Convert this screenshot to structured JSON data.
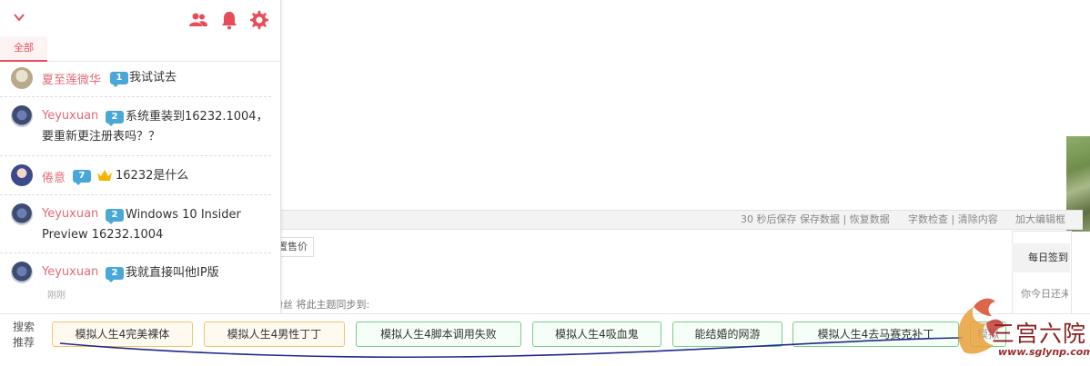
{
  "panel": {
    "tab_all": "全部",
    "messages": [
      {
        "user": "夏至莲微华",
        "level": "1",
        "text": "我试试去"
      },
      {
        "user": "Yeyuxuan",
        "level": "2",
        "text_line1": "系统重装到16232.1004，",
        "text_line2": "要重新更注册表吗？？"
      },
      {
        "user": "倦意",
        "level": "7",
        "text": "16232是什么"
      },
      {
        "user": "Yeyuxuan",
        "level": "2",
        "text_line1": "Windows 10 Insider",
        "text_line2": "Preview 16232.1004"
      },
      {
        "user": "Yeyuxuan",
        "level": "2",
        "text": "我就直接叫他IP版",
        "time": "刚刚"
      }
    ],
    "icons": [
      "chevron-down-icon",
      "users-icon",
      "bell-icon",
      "gear-icon"
    ],
    "accent": "#e84c5a"
  },
  "editor": {
    "autosave": "30 秒后保存 保存数据 | 恢复数据",
    "wordcheck": "字数检查 | 清除内容",
    "bigeditor": "加大编辑框",
    "price": "置售价",
    "sync": "粉丝 将此主题同步到:",
    "daily_title": "每日签到",
    "daily_note": "你今日还未"
  },
  "search": {
    "label_line1": "搜索",
    "label_line2": "推荐",
    "chips": [
      "模拟人生4完美裸体",
      "模拟人生4男性丁丁",
      "模拟人生4脚本调用失败",
      "模拟人生4吸血鬼",
      "能结婚的网游",
      "模拟人生4去马赛克补丁",
      "模拟"
    ]
  },
  "watermark": {
    "title": "三宫六院",
    "url": "www.sglynp.com"
  }
}
